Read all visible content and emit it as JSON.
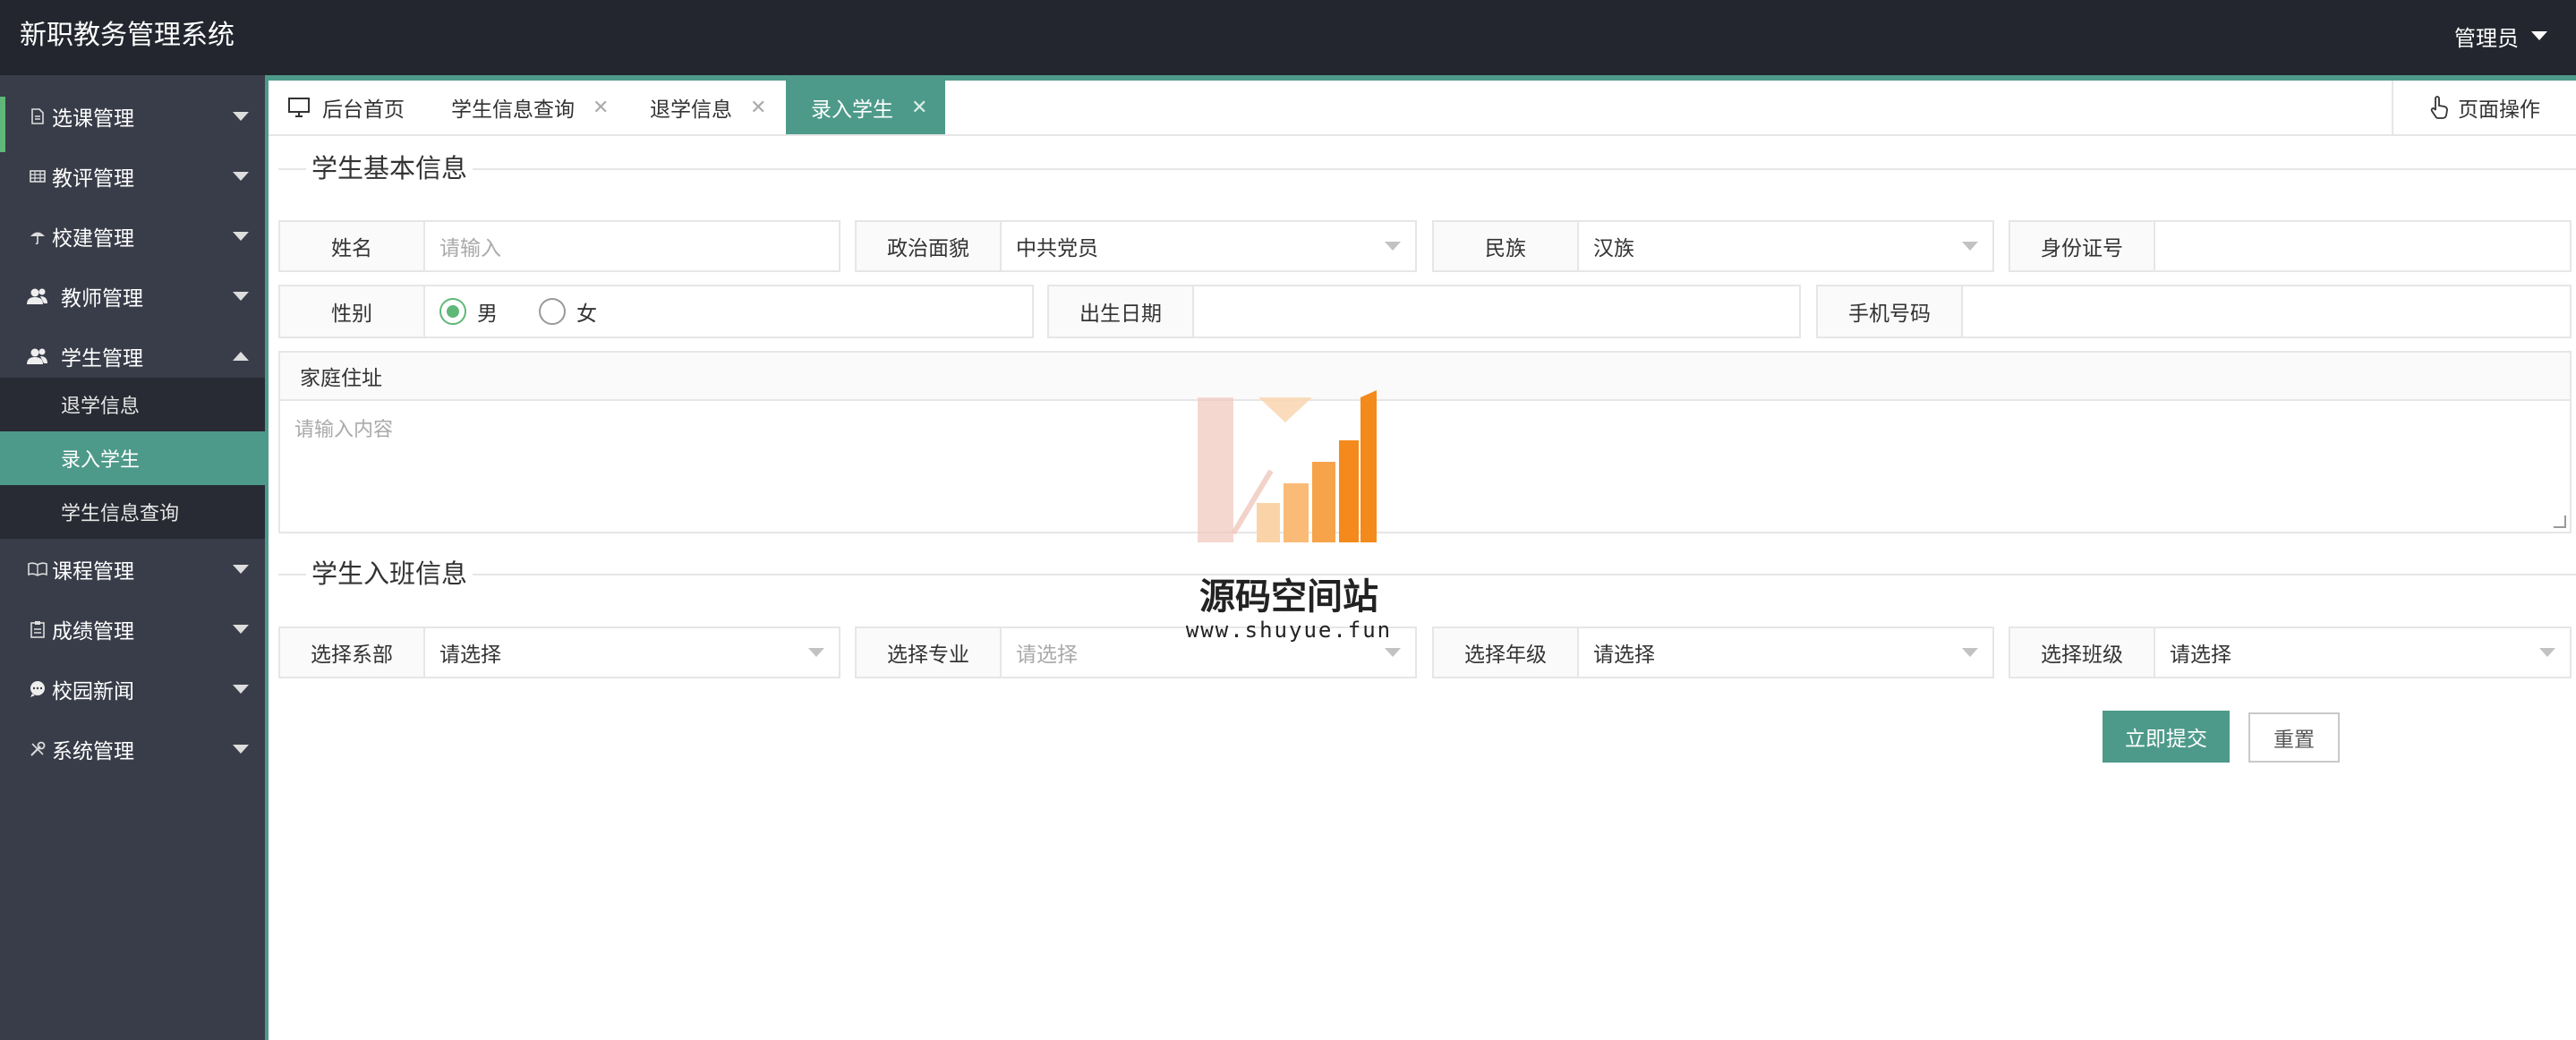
{
  "header": {
    "app_title": "新职教务管理系统",
    "user_label": "管理员"
  },
  "sidebar": {
    "items": [
      {
        "label": "选课管理",
        "icon": "file-icon"
      },
      {
        "label": "教评管理",
        "icon": "grid-icon"
      },
      {
        "label": "校建管理",
        "icon": "umbrella-icon"
      },
      {
        "label": "教师管理",
        "icon": "users-icon"
      },
      {
        "label": "学生管理",
        "icon": "users-icon",
        "expanded": true
      },
      {
        "label": "课程管理",
        "icon": "book-icon"
      },
      {
        "label": "成绩管理",
        "icon": "clipboard-icon"
      },
      {
        "label": "校园新闻",
        "icon": "chat-icon"
      },
      {
        "label": "系统管理",
        "icon": "tools-icon"
      }
    ],
    "sub_items": [
      {
        "label": "退学信息"
      },
      {
        "label": "录入学生",
        "active": true
      },
      {
        "label": "学生信息查询"
      }
    ]
  },
  "tabs": [
    {
      "label": "后台首页",
      "icon": "monitor-icon"
    },
    {
      "label": "学生信息查询",
      "close": "✕"
    },
    {
      "label": "退学信息",
      "close": "✕"
    },
    {
      "label": "录入学生",
      "close": "✕",
      "active": true
    }
  ],
  "page_ops_label": "页面操作",
  "form": {
    "section_basic": "学生基本信息",
    "section_class": "学生入班信息",
    "name_label": "姓名",
    "name_placeholder": "请输入",
    "political_label": "政治面貌",
    "political_value": "中共党员",
    "ethnic_label": "民族",
    "ethnic_value": "汉族",
    "id_label": "身份证号",
    "id_value": "",
    "gender_label": "性别",
    "gender_male": "男",
    "gender_female": "女",
    "gender_selected": "男",
    "birth_label": "出生日期",
    "birth_value": "",
    "phone_label": "手机号码",
    "phone_value": "",
    "address_label": "家庭住址",
    "address_placeholder": "请输入内容",
    "dept_label": "选择系部",
    "dept_value": "请选择",
    "major_label": "选择专业",
    "major_value": "请选择",
    "grade_label": "选择年级",
    "grade_value": "请选择",
    "class_label": "选择班级",
    "class_value": "请选择",
    "submit_label": "立即提交",
    "reset_label": "重置"
  },
  "watermark": {
    "text": "源码空间站",
    "url": "www.shuyue.fun"
  },
  "colors": {
    "header_bg": "#23262e",
    "sidebar_bg": "#393d49",
    "submenu_bg": "#282b33",
    "accent": "#4e9a8a",
    "radio_green": "#5fb878"
  }
}
